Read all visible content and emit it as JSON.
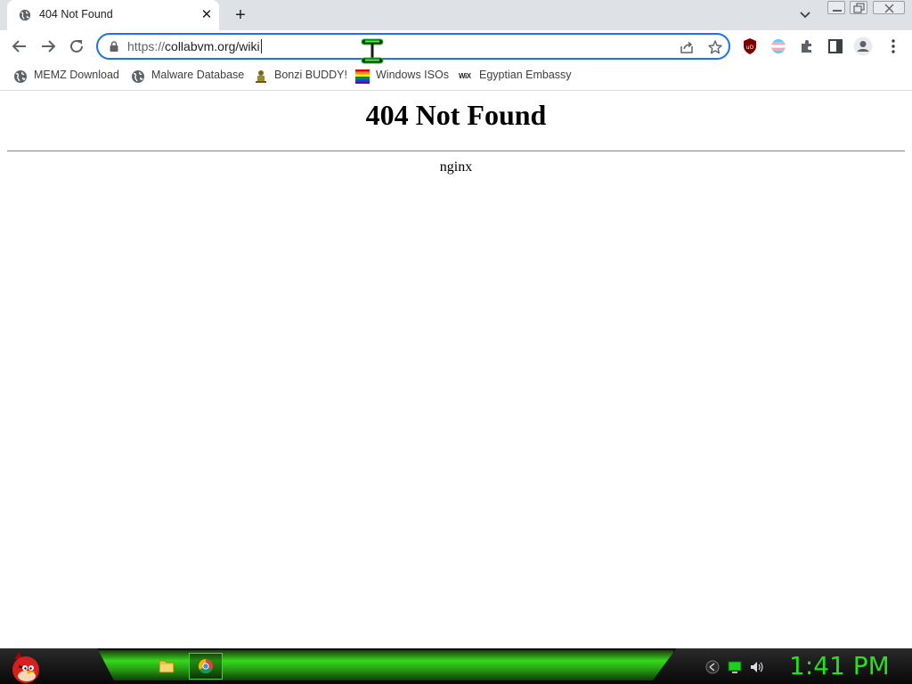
{
  "browser": {
    "tab": {
      "title": "404 Not Found",
      "favicon": "globe-icon"
    },
    "new_tab_label": "+",
    "address_bar": {
      "scheme": "https://",
      "rest": "collabvm.org/wiki"
    },
    "accent_color": "#1a73e8"
  },
  "bookmarks": [
    {
      "label": "MEMZ Download",
      "icon": "globe-icon"
    },
    {
      "label": "Malware Database",
      "icon": "globe-icon"
    },
    {
      "label": "Bonzi BUDDY!",
      "icon": "bonzi-icon"
    },
    {
      "label": "Windows ISOs",
      "icon": "rainbow-flag-icon"
    },
    {
      "label": "Egyptian Embassy",
      "icon": "wix-icon",
      "icon_text": "WiX"
    }
  ],
  "page": {
    "heading": "404 Not Found",
    "server": "nginx"
  },
  "extensions": [
    "ublock-icon",
    "trans-flag-icon",
    "puzzle-icon",
    "side-panel-icon",
    "profile-icon",
    "kebab-menu-icon"
  ],
  "taskbar": {
    "clock": "1:41 PM",
    "clock_color": "#28e01c",
    "glow_color": "#37d81a"
  }
}
